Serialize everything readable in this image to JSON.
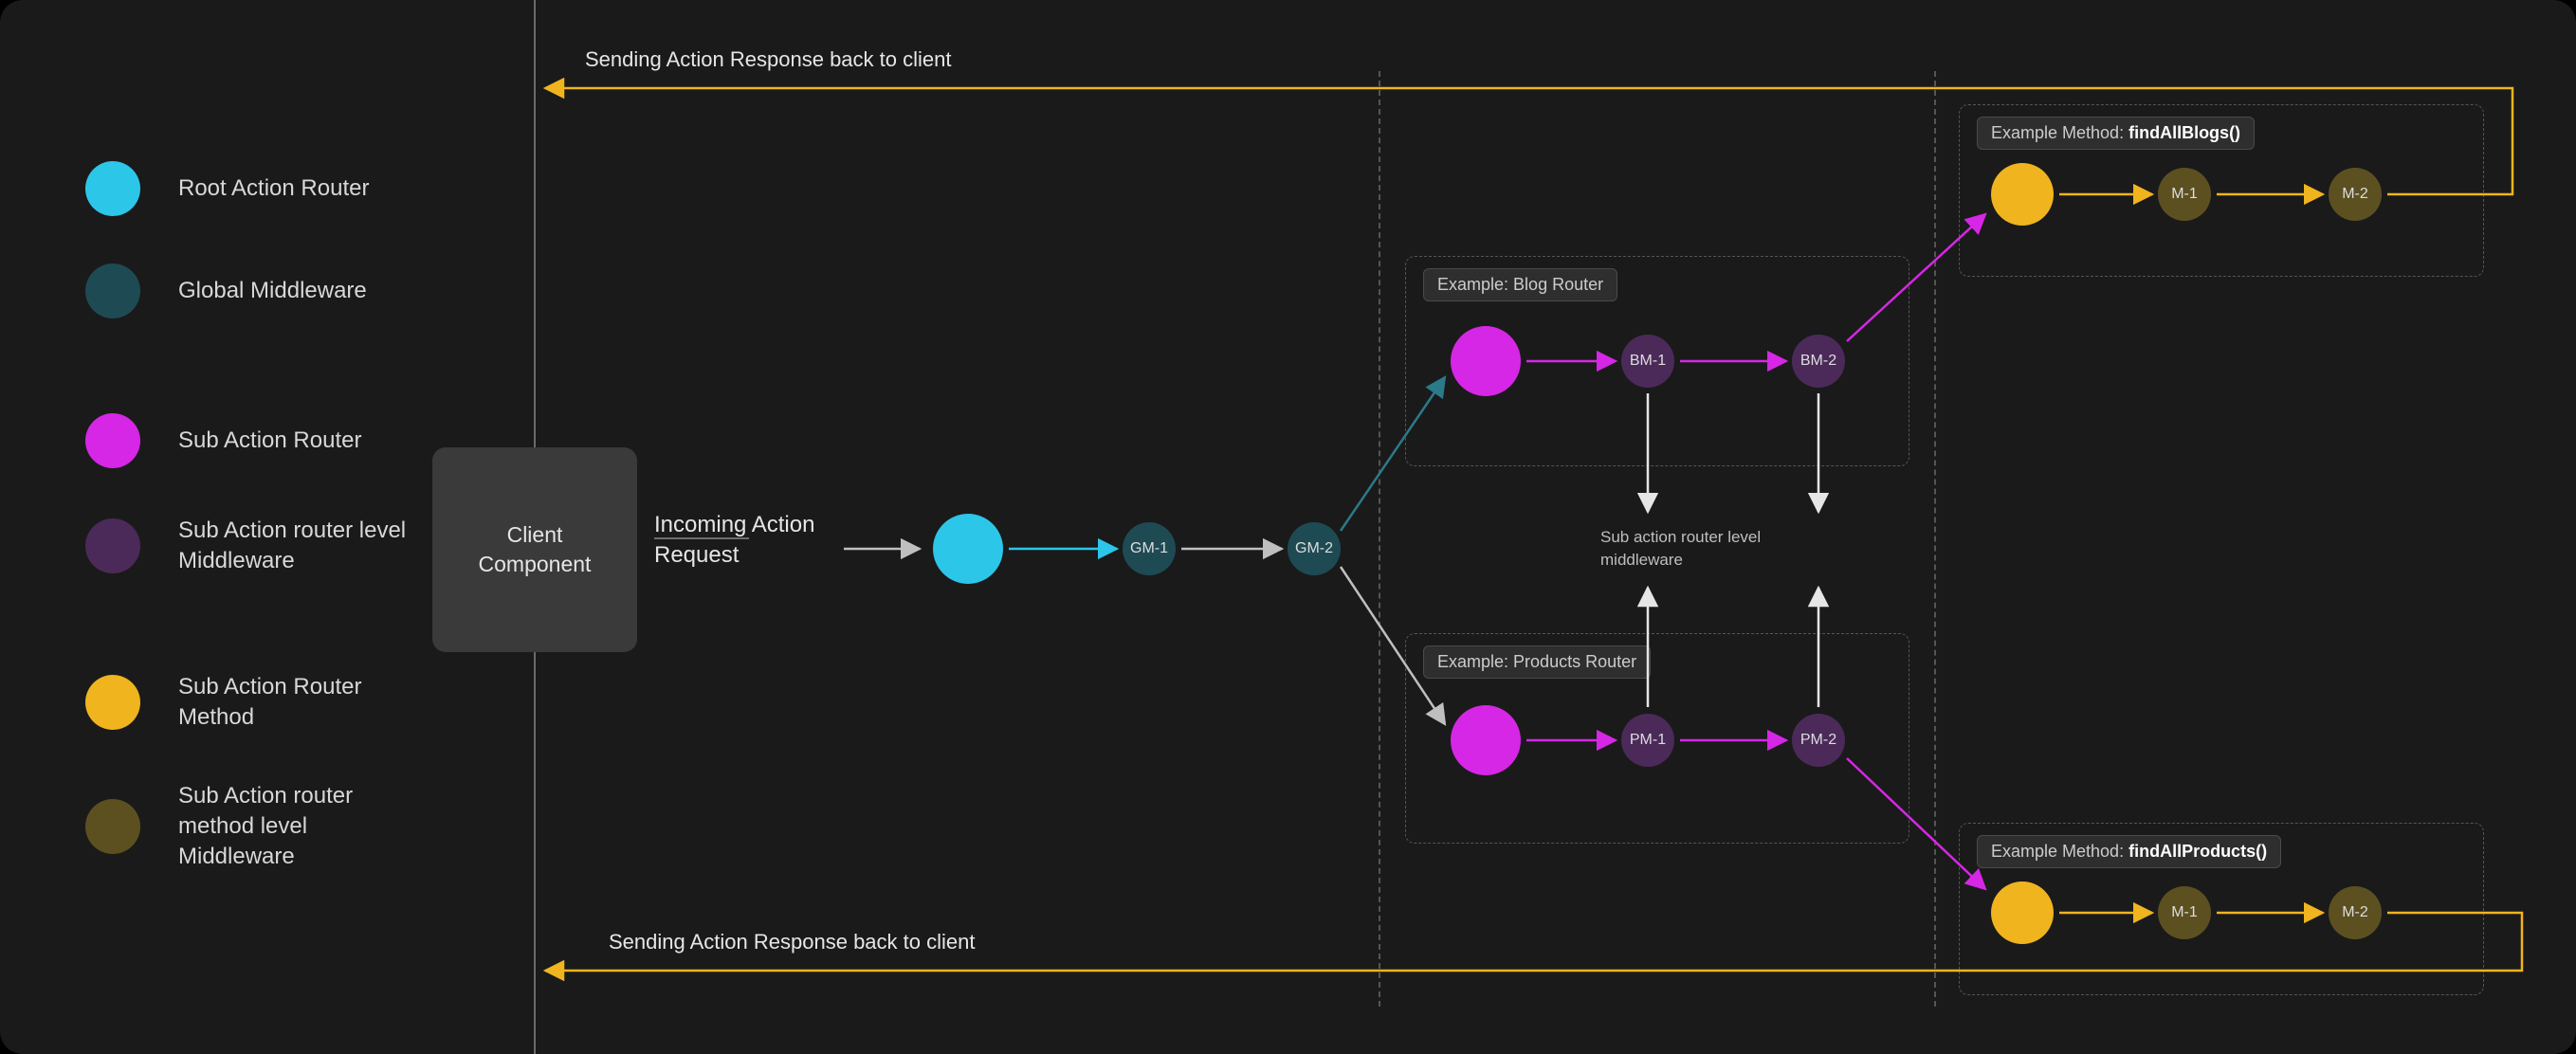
{
  "legend": {
    "root_router": "Root Action Router",
    "global_mw": "Global Middleware",
    "sub_router": "Sub Action Router",
    "sub_router_mw": "Sub Action router level Middleware",
    "method": "Sub Action Router Method",
    "method_mw": "Sub Action router method level Middleware"
  },
  "client_component": "Client\nComponent",
  "incoming_request": "Incoming Action\nRequest",
  "response_top": "Sending Action Response back to client",
  "response_bottom": "Sending Action Response back to client",
  "global_flow": {
    "gm1": "GM-1",
    "gm2": "GM-2"
  },
  "blog_panel": {
    "label_prefix": "Example: ",
    "label_name": "Blog Router",
    "bm1": "BM-1",
    "bm2": "BM-2"
  },
  "products_panel": {
    "label_prefix": "Example: ",
    "label_name": "Products Router",
    "pm1": "PM-1",
    "pm2": "PM-2"
  },
  "mid_note": "Sub action router level\nmiddleware",
  "blogs_method_panel": {
    "label_prefix": "Example Method: ",
    "label_name": "findAllBlogs()",
    "m1": "M-1",
    "m2": "M-2"
  },
  "products_method_panel": {
    "label_prefix": "Example Method: ",
    "label_name": "findAllProducts()",
    "m1": "M-1",
    "m2": "M-2"
  },
  "colors": {
    "cyan": "#2cc6e9",
    "teal": "#1e4a54",
    "magenta": "#d527e5",
    "purple": "#4b2a5a",
    "amber": "#f0b41e",
    "olive": "#5c5021",
    "arrow_default": "#bfbfbf"
  }
}
